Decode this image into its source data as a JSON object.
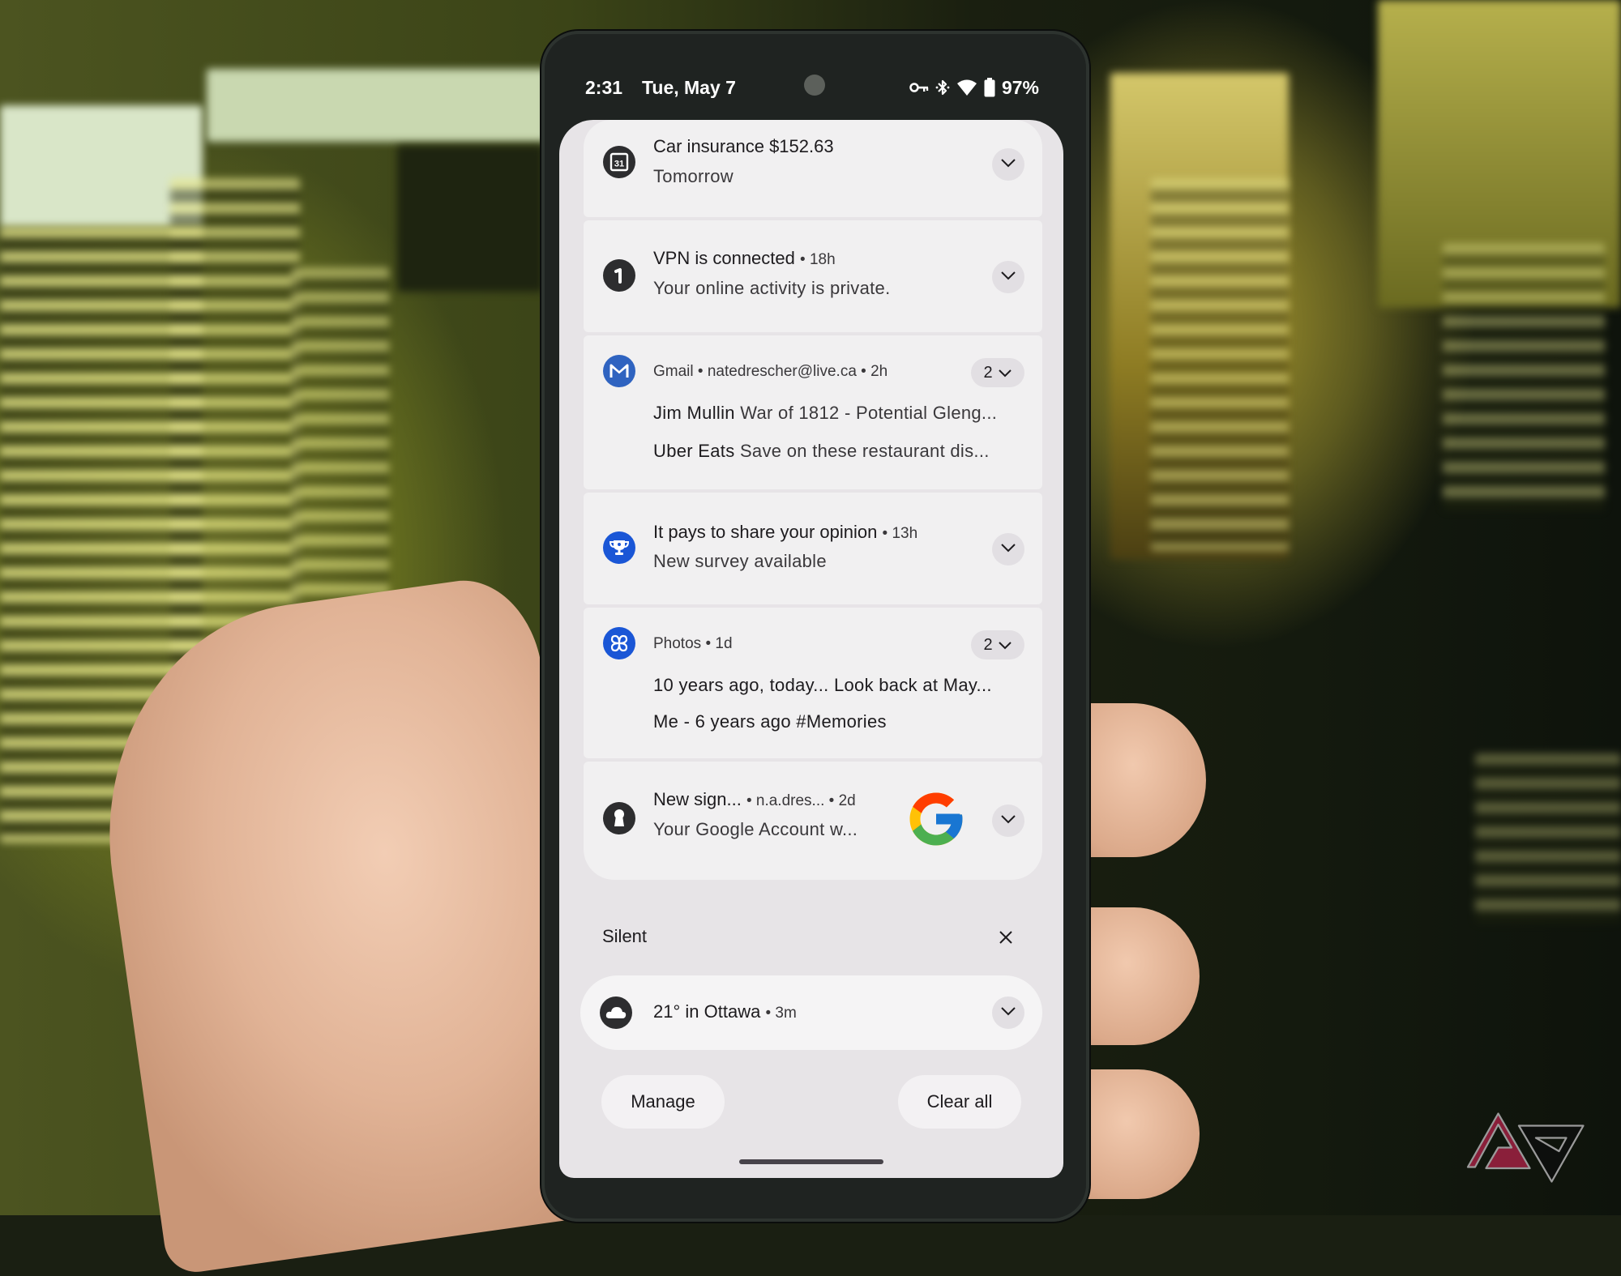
{
  "status_bar": {
    "time": "2:31",
    "date": "Tue, May 7",
    "icons": [
      "vpn-key-icon",
      "bluetooth-icon",
      "wifi-icon",
      "battery-icon"
    ],
    "battery_percent": "97%"
  },
  "notifications": [
    {
      "app_icon": "calendar-icon",
      "title": "Car insurance $152.63",
      "text": "Tomorrow",
      "action": "expand"
    },
    {
      "app_icon": "vpn-icon",
      "title": "VPN is connected",
      "time": "18h",
      "text": "Your online activity is private.",
      "action": "expand"
    },
    {
      "app_icon": "gmail-icon",
      "app_name": "Gmail",
      "account": "natedrescher@live.ca",
      "time": "2h",
      "count": "2",
      "messages": [
        {
          "sender": "Jim Mullin",
          "subject": "War of 1812 - Potential Gleng..."
        },
        {
          "sender": "Uber Eats",
          "subject": "Save on these restaurant dis..."
        }
      ]
    },
    {
      "app_icon": "trophy-icon",
      "title": "It pays to share your opinion",
      "time": "13h",
      "text": "New survey available",
      "action": "expand"
    },
    {
      "app_icon": "photos-pinwheel-icon",
      "app_name": "Photos",
      "time": "1d",
      "count": "2",
      "messages": [
        {
          "text": "10 years ago, today... Look back at May..."
        },
        {
          "text": "Me - 6 years ago #Memories"
        }
      ]
    },
    {
      "app_icon": "keyhole-icon",
      "title": "New sign...",
      "account": "n.a.dres...",
      "time": "2d",
      "text": "Your Google Account w...",
      "large_icon": "google-g-logo",
      "action": "expand"
    }
  ],
  "silent_section": {
    "label": "Silent",
    "notification": {
      "app_icon": "cloud-icon",
      "title": "21° in Ottawa",
      "time": "3m"
    }
  },
  "footer": {
    "manage_label": "Manage",
    "clear_all_label": "Clear all"
  },
  "separator": "•",
  "colors": {
    "shade_background": "#e7e4e7",
    "card_background": "#f1f0f1",
    "accent_blue": "#1a56d6",
    "watermark_red": "#8a1f3a"
  }
}
